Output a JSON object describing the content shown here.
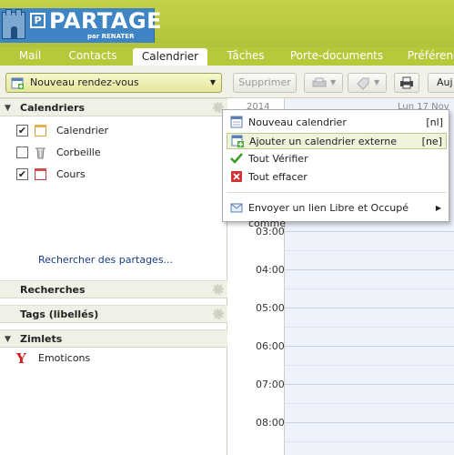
{
  "brand": {
    "name": "PARTAGE",
    "sub": "par RENATER",
    "box": "P"
  },
  "tabs": [
    {
      "label": "Mail",
      "active": false
    },
    {
      "label": "Contacts",
      "active": false
    },
    {
      "label": "Calendrier",
      "active": true
    },
    {
      "label": "Tâches",
      "active": false
    },
    {
      "label": "Porte-documents",
      "active": false
    },
    {
      "label": "Préférences",
      "active": false
    }
  ],
  "toolbar": {
    "new_appointment": "Nouveau rendez-vous",
    "delete": "Supprimer",
    "next": "Auj"
  },
  "sections": {
    "calendars": "Calendriers",
    "searches": "Recherches",
    "tags": "Tags (libellés)",
    "zimlets": "Zimlets"
  },
  "calendars": [
    {
      "label": "Calendrier",
      "checked": true,
      "check": "✔",
      "icon": "calendar-icon"
    },
    {
      "label": "Corbeille",
      "checked": false,
      "check": "",
      "icon": "trash-icon"
    },
    {
      "label": "Cours",
      "checked": true,
      "check": "✔",
      "icon": "calendar-icon"
    }
  ],
  "search_shares": "Rechercher des partages...",
  "zimlets": [
    {
      "label": "Emoticons",
      "icon": "yahoo-icon"
    }
  ],
  "calendar_header": {
    "year": "2014",
    "date": "Lun 17 Nov"
  },
  "hours": [
    "03:00",
    "04:00",
    "05:00",
    "06:00",
    "07:00",
    "08:00"
  ],
  "menu": {
    "items": [
      {
        "label": "Nouveau calendrier",
        "shortcut": "[nl]",
        "icon": "calendar-icon"
      },
      {
        "label": "Ajouter un calendrier externe",
        "shortcut": "[ne]",
        "icon": "calendar-add-icon",
        "selected": true
      },
      {
        "label": "Tout Vérifier",
        "icon": "check-icon"
      },
      {
        "label": "Tout effacer",
        "icon": "clear-icon"
      },
      {
        "label": "Envoyer un lien Libre et Occupé comme",
        "icon": "mail-icon",
        "submenu": true
      }
    ]
  }
}
